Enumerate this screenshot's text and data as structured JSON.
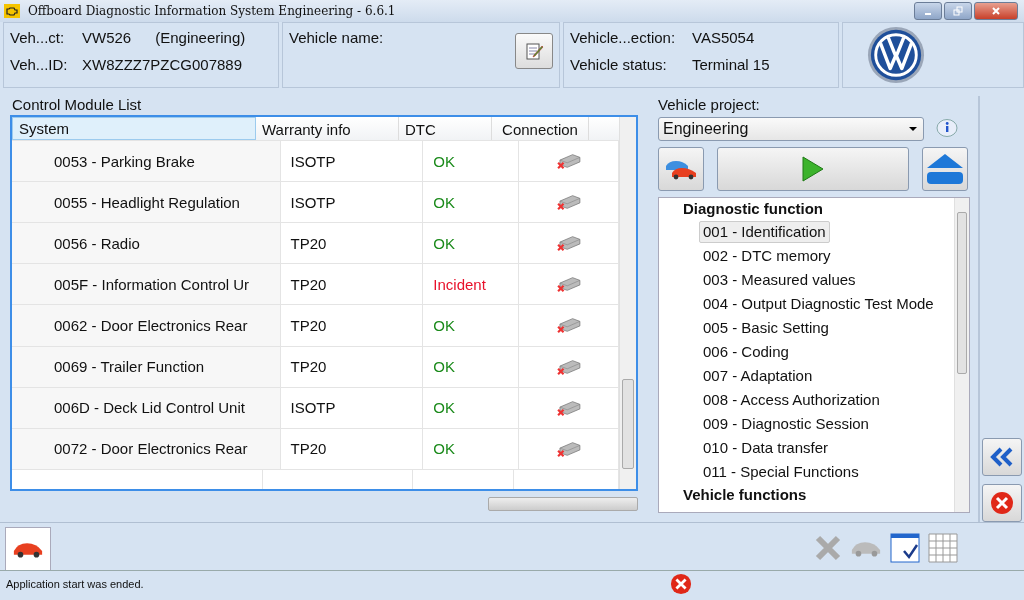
{
  "window": {
    "title": "Offboard Diagnostic Information System Engineering - 6.6.1"
  },
  "header": {
    "fields": [
      {
        "label": "Veh...ct:",
        "value": "VW526",
        "extra": "(Engineering)"
      },
      {
        "label": "Veh...ID:",
        "value": "XW8ZZZ7PZCG007889"
      }
    ],
    "name_label": "Vehicle name:",
    "status_fields": [
      {
        "label": "Vehicle...ection:",
        "value": "VAS5054"
      },
      {
        "label": "Vehicle status:",
        "value": "Terminal 15"
      }
    ]
  },
  "module_list": {
    "title": "Control Module List",
    "columns": [
      "System",
      "Warranty info",
      "DTC",
      "Connection"
    ],
    "rows": [
      {
        "system": "0053 - Parking Brake",
        "warranty": "ISOTP",
        "dtc": "OK",
        "color": "#1a8a1a"
      },
      {
        "system": "0055 - Headlight Regulation",
        "warranty": "ISOTP",
        "dtc": "OK",
        "color": "#1a8a1a"
      },
      {
        "system": "0056 - Radio",
        "warranty": "TP20",
        "dtc": "OK",
        "color": "#1a8a1a"
      },
      {
        "system": "005F - Information Control Ur",
        "warranty": "TP20",
        "dtc": "Incident",
        "color": "#e8102a"
      },
      {
        "system": "0062 - Door Electronics Rear",
        "warranty": "TP20",
        "dtc": "OK",
        "color": "#1a8a1a"
      },
      {
        "system": "0069 - Trailer Function",
        "warranty": "TP20",
        "dtc": "OK",
        "color": "#1a8a1a"
      },
      {
        "system": "006D - Deck Lid Control Unit",
        "warranty": "ISOTP",
        "dtc": "OK",
        "color": "#1a8a1a"
      },
      {
        "system": "0072 - Door Electronics Rear",
        "warranty": "TP20",
        "dtc": "OK",
        "color": "#1a8a1a"
      }
    ]
  },
  "project": {
    "label": "Vehicle project:",
    "value": "Engineering"
  },
  "functions": [
    {
      "label": "Diagnostic function",
      "children": [
        {
          "label": "001 - Identification",
          "selected": true
        },
        {
          "label": "002 - DTC memory",
          "selected": false
        },
        {
          "label": "003 - Measured values",
          "selected": false
        },
        {
          "label": "004 - Output Diagnostic Test Mode",
          "selected": false
        },
        {
          "label": "005 - Basic Setting",
          "selected": false
        },
        {
          "label": "006 - Coding",
          "selected": false
        },
        {
          "label": "007 - Adaptation",
          "selected": false
        },
        {
          "label": "008 - Access Authorization",
          "selected": false
        },
        {
          "label": "009 - Diagnostic Session",
          "selected": false
        },
        {
          "label": "010 - Data transfer",
          "selected": false
        },
        {
          "label": "011 - Special Functions",
          "selected": false
        }
      ]
    },
    {
      "label": "Vehicle functions"
    }
  ],
  "status_bar": "Application start was ended."
}
